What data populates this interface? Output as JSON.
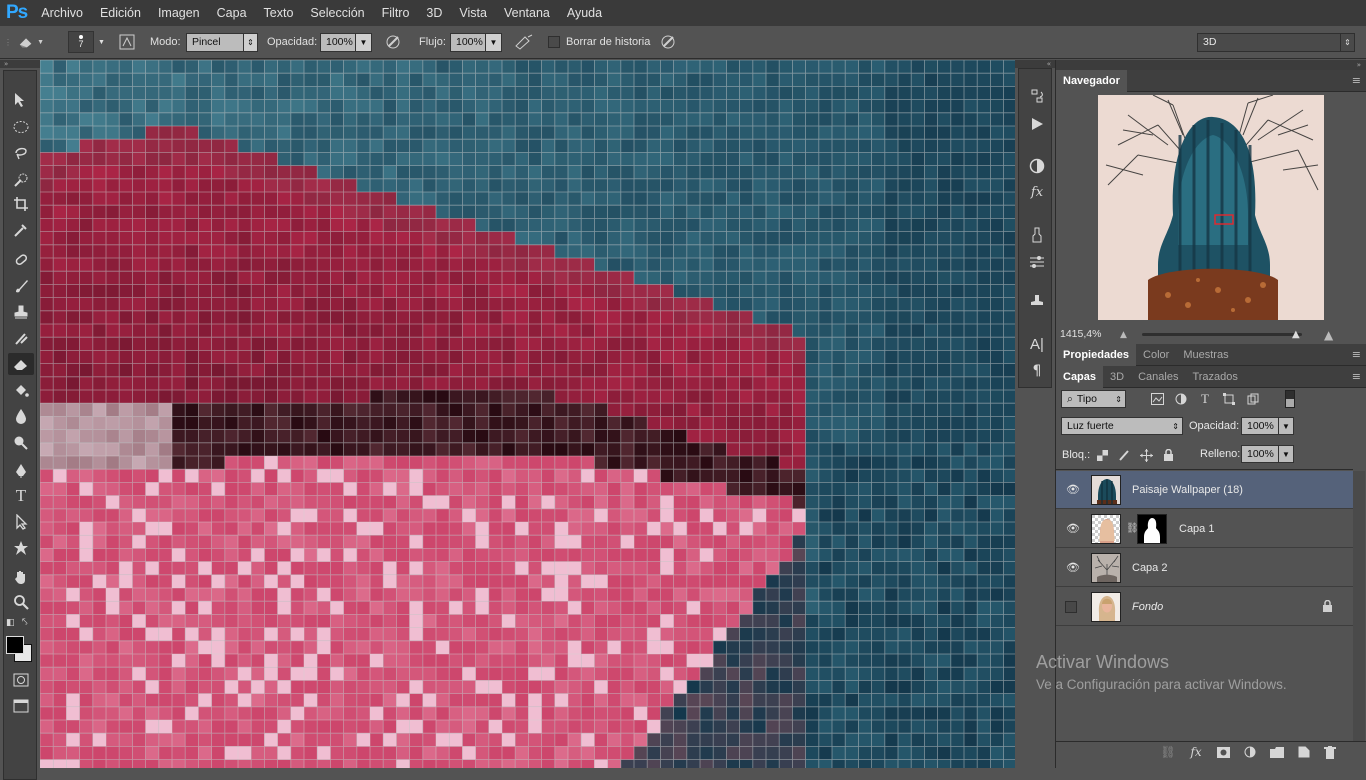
{
  "app": {
    "logo": "Ps"
  },
  "menu": [
    "Archivo",
    "Edición",
    "Imagen",
    "Capa",
    "Texto",
    "Selección",
    "Filtro",
    "3D",
    "Vista",
    "Ventana",
    "Ayuda"
  ],
  "options": {
    "brush_size": "7",
    "mode_label": "Modo:",
    "mode_value": "Pincel",
    "opacity_label": "Opacidad:",
    "opacity_value": "100%",
    "flow_label": "Flujo:",
    "flow_value": "100%",
    "erase_history_label": "Borrar de historia",
    "workspace_value": "3D"
  },
  "navigator": {
    "tab": "Navegador",
    "zoom": "1415,4%"
  },
  "props_tabs": [
    "Propiedades",
    "Color",
    "Muestras"
  ],
  "layers_panel": {
    "tabs": [
      "Capas",
      "3D",
      "Canales",
      "Trazados"
    ],
    "filter_value": "Tipo",
    "blend_mode": "Luz fuerte",
    "opacity_label": "Opacidad:",
    "opacity_value": "100%",
    "lock_label": "Bloq.:",
    "fill_label": "Relleno:",
    "fill_value": "100%",
    "layers": [
      {
        "name": "Paisaje Wallpaper (18)",
        "visible": true,
        "selected": true
      },
      {
        "name": "Capa 1",
        "visible": true,
        "selected": false
      },
      {
        "name": "Capa 2",
        "visible": true,
        "selected": false
      },
      {
        "name": "Fondo",
        "visible": false,
        "selected": false
      }
    ]
  },
  "watermark": {
    "title": "Activar Windows",
    "subtitle": "Ve a Configuración para activar Windows."
  },
  "colors": {
    "accent": "#31a8ff",
    "menubar": "#3a3a3a",
    "panel": "#535353",
    "selected_layer": "#55627a"
  }
}
